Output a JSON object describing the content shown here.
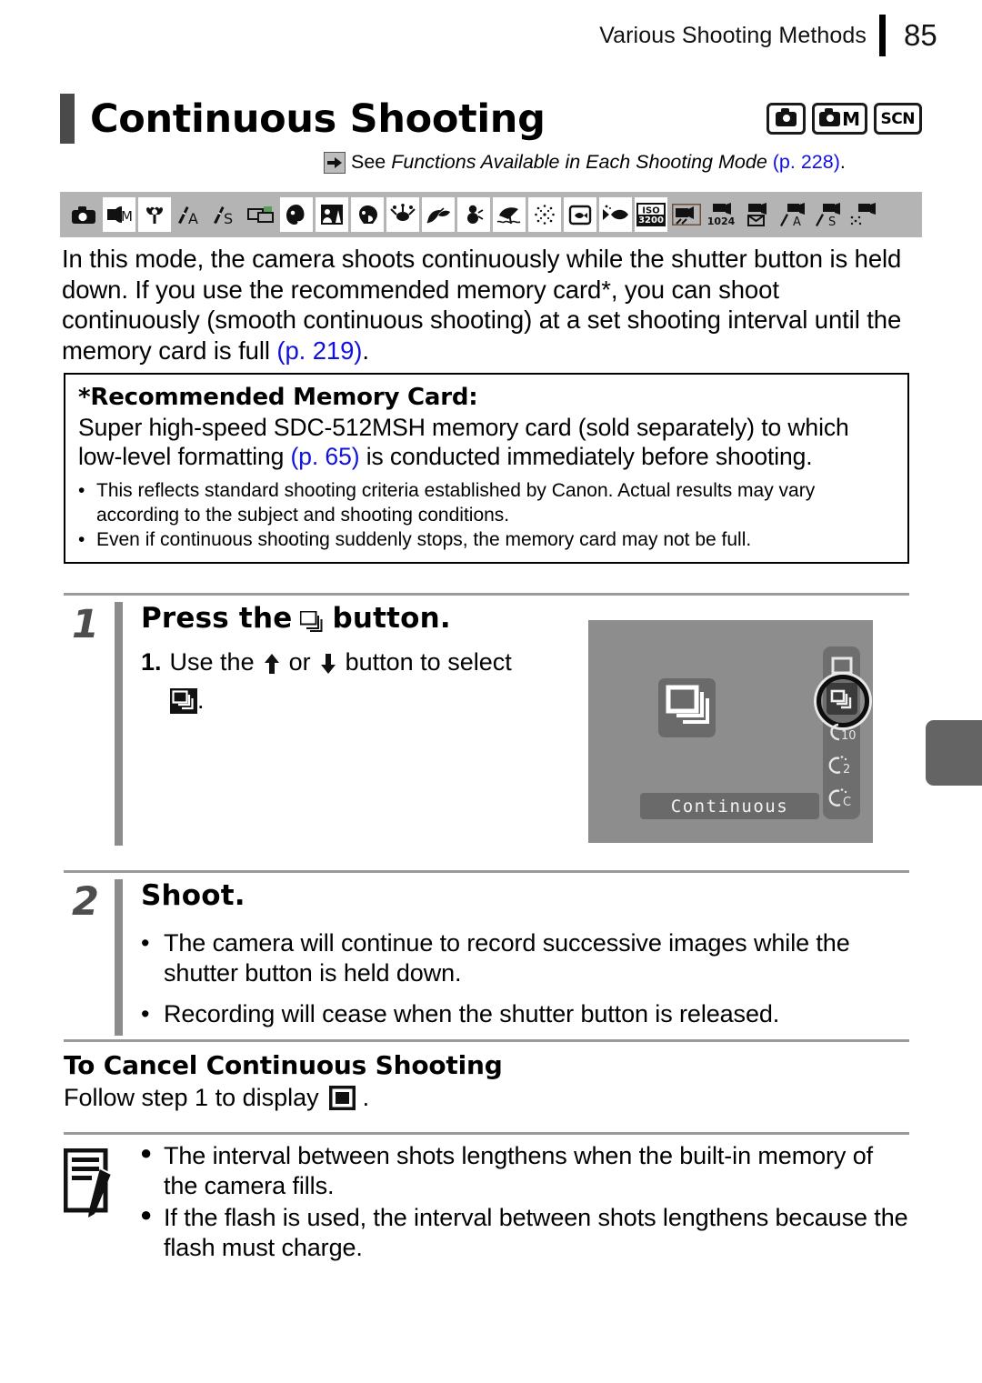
{
  "header": {
    "title": "Various Shooting Methods",
    "page_number": "85"
  },
  "title_block": {
    "heading": "Continuous Shooting",
    "mode_badges": [
      {
        "name": "auto-mode-badge",
        "label": ""
      },
      {
        "name": "manual-mode-badge",
        "label": "M"
      },
      {
        "name": "scene-mode-badge",
        "label": "SCN"
      }
    ]
  },
  "see_also": {
    "prefix": "See ",
    "italic": "Functions Available in Each Shooting Mode",
    "page_ref": " (p. 228)",
    "suffix": "."
  },
  "mode_icon_strip": [
    {
      "name": "auto-icon",
      "inverted": true
    },
    {
      "name": "manual-icon",
      "inverted": false
    },
    {
      "name": "digital-macro-icon",
      "inverted": false
    },
    {
      "name": "aperture-priority-icon",
      "inverted": true,
      "label": "A"
    },
    {
      "name": "shutter-priority-icon",
      "inverted": true,
      "label": "S"
    },
    {
      "name": "stitch-assist-icon",
      "inverted": true
    },
    {
      "name": "portrait-icon",
      "inverted": false
    },
    {
      "name": "night-snapshot-icon",
      "inverted": false
    },
    {
      "name": "kids-and-pets-icon",
      "inverted": false
    },
    {
      "name": "indoor-icon",
      "inverted": false
    },
    {
      "name": "foliage-icon",
      "inverted": false
    },
    {
      "name": "snow-icon",
      "inverted": false
    },
    {
      "name": "beach-icon",
      "inverted": false
    },
    {
      "name": "fireworks-icon",
      "inverted": false
    },
    {
      "name": "aquarium-icon",
      "inverted": false
    },
    {
      "name": "underwater-icon",
      "inverted": false
    },
    {
      "name": "iso-3200-icon",
      "inverted": false,
      "label": "ISO 3200"
    },
    {
      "name": "movie-standard-icon",
      "inverted": true
    },
    {
      "name": "movie-compact-icon",
      "inverted": true,
      "label": "1024"
    },
    {
      "name": "movie-mail-icon",
      "inverted": true
    },
    {
      "name": "movie-aperture-icon",
      "inverted": true,
      "label": "A"
    },
    {
      "name": "movie-shutter-icon",
      "inverted": true,
      "label": "S"
    },
    {
      "name": "movie-color-accent-icon",
      "inverted": true
    }
  ],
  "lead_paragraph": {
    "part1": "In this mode, the camera shoots continuously while the shutter button is held down. If you use the recommended memory card*, you can shoot continuously (smooth continuous shooting) at a set shooting interval until the memory card is full ",
    "page_ref": "(p. 219)",
    "part2": "."
  },
  "memory_card_box": {
    "heading": "*Recommended Memory Card:",
    "body_part1": "Super high-speed SDC-512MSH memory card (sold separately) to which low-level formatting ",
    "page_ref": "(p. 65)",
    "body_part2": " is conducted immediately before shooting.",
    "bullets": [
      "This reflects standard shooting criteria established by Canon. Actual results may vary according to the subject and shooting conditions.",
      "Even if continuous shooting suddenly stops, the memory card may not be full."
    ],
    "bullet_marker": "•"
  },
  "steps": [
    {
      "number": "1",
      "title_prefix": "Press the",
      "title_suffix": "button.",
      "sub_number": "1.",
      "sub_part1": "Use the",
      "sub_or": "or",
      "sub_part2": "button to select",
      "sub_end": "."
    },
    {
      "number": "2",
      "title": "Shoot.",
      "bullets": [
        "The camera will continue to record successive images while the shutter button is held down.",
        "Recording will cease when the shutter button is released."
      ],
      "bullet_marker": "•"
    }
  ],
  "lcd_screen": {
    "label": "Continuous",
    "sidebar_items": [
      {
        "name": "drive-single-icon",
        "selected": false
      },
      {
        "name": "drive-continuous-icon",
        "selected": true
      },
      {
        "name": "timer-10-icon",
        "selected": false,
        "label": "10"
      },
      {
        "name": "timer-2-icon",
        "selected": false,
        "label": "2"
      },
      {
        "name": "timer-custom-icon",
        "selected": false,
        "label": "C"
      }
    ]
  },
  "cancel_section": {
    "heading": "To Cancel Continuous Shooting",
    "body_prefix": "Follow step 1 to display",
    "body_suffix": "."
  },
  "note_section": {
    "bullet_marker": "●",
    "bullets": [
      "The interval between shots lengthens when the built-in memory of the camera fills.",
      "If the flash is used, the interval between shots lengthens because the flash must charge."
    ]
  },
  "colors": {
    "link": "#1111dd",
    "title_accent": "#4a4a4a",
    "strip_bg": "#b4b4b4",
    "lcd_bg": "#8d8d8d",
    "rule": "#9a9a9a"
  }
}
